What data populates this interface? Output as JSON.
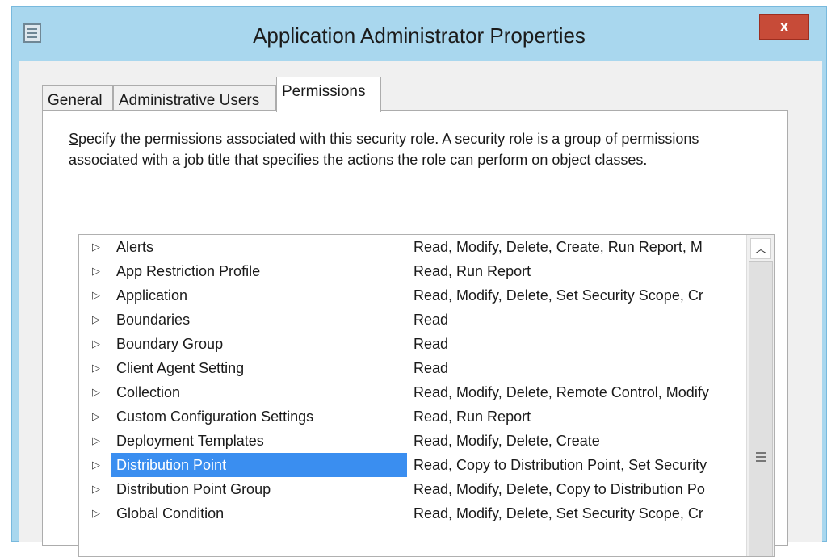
{
  "window": {
    "title": "Application Administrator Properties",
    "close_label": "x"
  },
  "tabs": [
    {
      "label": "General",
      "active": false
    },
    {
      "label": "Administrative Users",
      "active": false
    },
    {
      "label": "Permissions",
      "active": true
    }
  ],
  "description": {
    "mnemonic": "S",
    "text": "pecify the permissions associated with this security role. A security role is a group of permissions associated with a job title that specifies the actions the role can perform on object classes."
  },
  "permissions_list": {
    "rows": [
      {
        "name": "Alerts",
        "permissions": "Read, Modify, Delete, Create, Run Report, M"
      },
      {
        "name": "App Restriction Profile",
        "permissions": "Read, Run Report"
      },
      {
        "name": "Application",
        "permissions": "Read, Modify, Delete, Set Security Scope, Cr"
      },
      {
        "name": "Boundaries",
        "permissions": "Read"
      },
      {
        "name": "Boundary Group",
        "permissions": "Read"
      },
      {
        "name": "Client Agent Setting",
        "permissions": "Read"
      },
      {
        "name": "Collection",
        "permissions": "Read, Modify, Delete, Remote Control, Modify"
      },
      {
        "name": "Custom Configuration Settings",
        "permissions": "Read, Run Report"
      },
      {
        "name": "Deployment Templates",
        "permissions": "Read, Modify, Delete, Create"
      },
      {
        "name": "Distribution Point",
        "permissions": "Read, Copy to Distribution Point, Set Security"
      },
      {
        "name": "Distribution Point Group",
        "permissions": "Read, Modify, Delete, Copy to Distribution Po"
      },
      {
        "name": "Global Condition",
        "permissions": "Read, Modify, Delete, Set Security Scope, Cr"
      }
    ],
    "selected_index": 9,
    "expand_icon": "triangle-right-icon"
  },
  "colors": {
    "title_bar": "#a9d7ee",
    "close_button": "#c74b38",
    "selection": "#3a8ef0"
  }
}
